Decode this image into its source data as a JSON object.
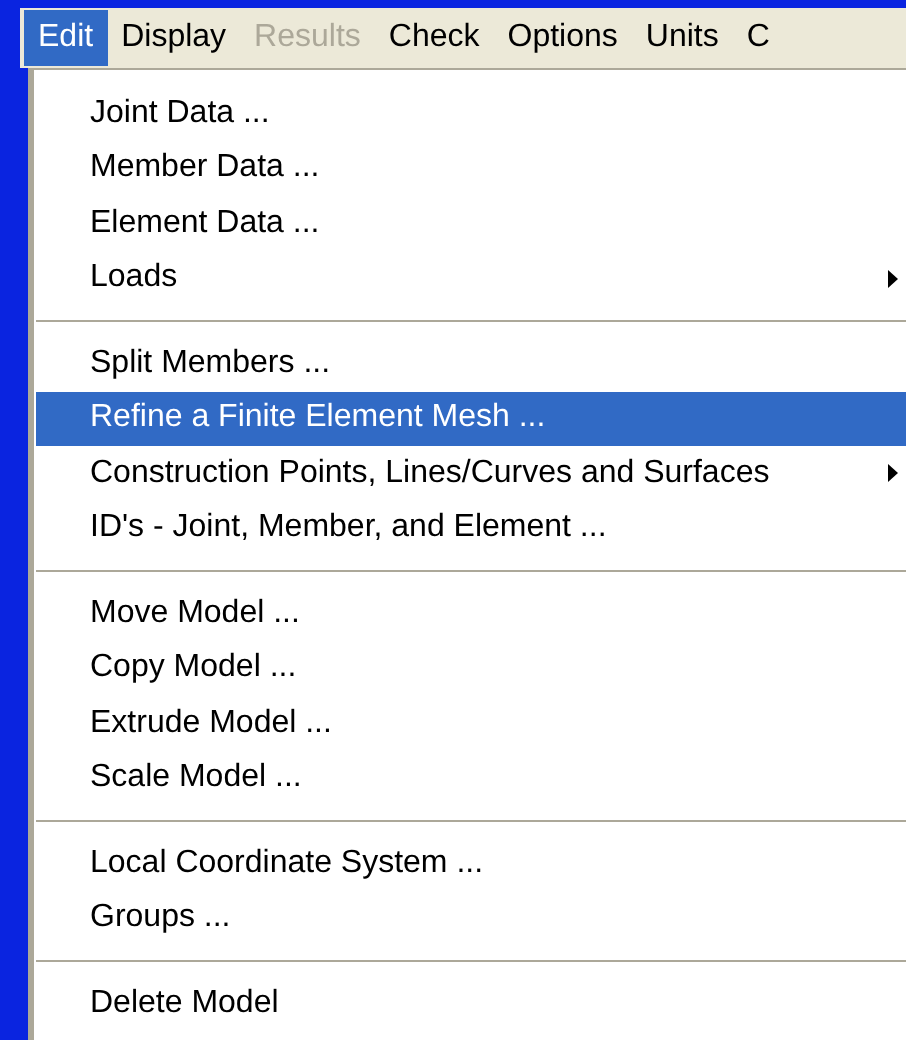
{
  "menu_bar": [
    {
      "label": "Edit",
      "selected": true,
      "disabled": false
    },
    {
      "label": "Display",
      "selected": false,
      "disabled": false
    },
    {
      "label": "Results",
      "selected": false,
      "disabled": true
    },
    {
      "label": "Check",
      "selected": false,
      "disabled": false
    },
    {
      "label": "Options",
      "selected": false,
      "disabled": false
    },
    {
      "label": "Units",
      "selected": false,
      "disabled": false
    },
    {
      "label": "C",
      "selected": false,
      "disabled": false
    }
  ],
  "menu": {
    "items": [
      {
        "kind": "item",
        "label": "Joint Data ...",
        "submenu": false,
        "selected": false
      },
      {
        "kind": "item",
        "label": "Member Data ...",
        "submenu": false,
        "selected": false
      },
      {
        "kind": "item",
        "label": "Element Data ...",
        "submenu": false,
        "selected": false
      },
      {
        "kind": "item",
        "label": "Loads",
        "submenu": true,
        "selected": false
      },
      {
        "kind": "separator"
      },
      {
        "kind": "item",
        "label": "Split Members ...",
        "submenu": false,
        "selected": false
      },
      {
        "kind": "item",
        "label": "Refine a Finite Element Mesh ...",
        "submenu": false,
        "selected": true
      },
      {
        "kind": "item",
        "label": "Construction Points, Lines/Curves and Surfaces",
        "submenu": true,
        "selected": false
      },
      {
        "kind": "item",
        "label": "ID's - Joint, Member, and Element ...",
        "submenu": false,
        "selected": false
      },
      {
        "kind": "separator"
      },
      {
        "kind": "item",
        "label": "Move Model ...",
        "submenu": false,
        "selected": false
      },
      {
        "kind": "item",
        "label": "Copy Model ...",
        "submenu": false,
        "selected": false
      },
      {
        "kind": "item",
        "label": "Extrude Model ...",
        "submenu": false,
        "selected": false
      },
      {
        "kind": "item",
        "label": "Scale Model ...",
        "submenu": false,
        "selected": false
      },
      {
        "kind": "separator"
      },
      {
        "kind": "item",
        "label": "Local Coordinate System ...",
        "submenu": false,
        "selected": false
      },
      {
        "kind": "item",
        "label": "Groups ...",
        "submenu": false,
        "selected": false
      },
      {
        "kind": "separator"
      },
      {
        "kind": "item",
        "label": "Delete Model",
        "submenu": false,
        "selected": false
      }
    ]
  }
}
